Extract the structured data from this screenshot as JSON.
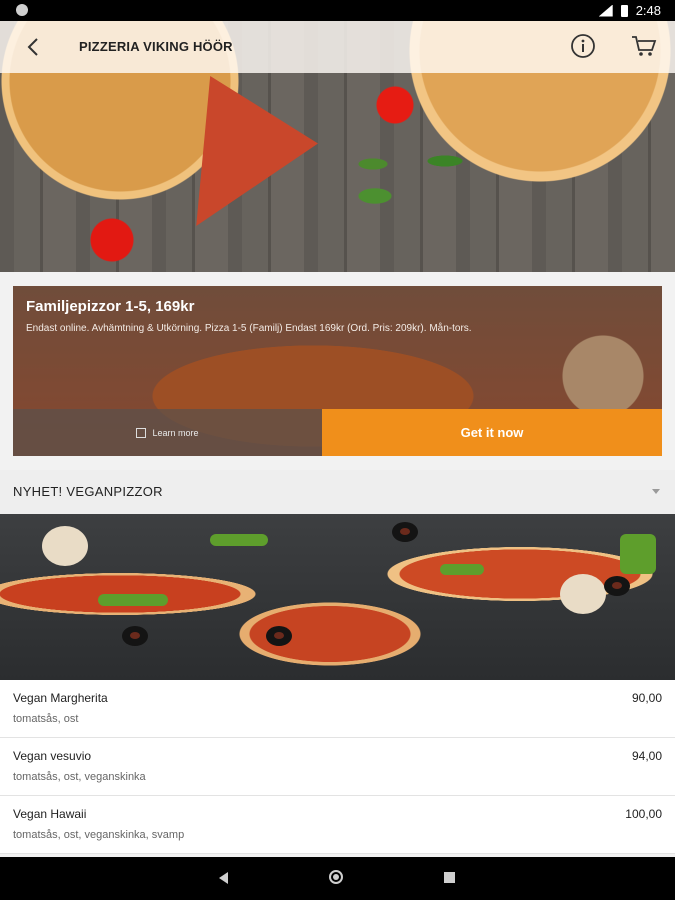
{
  "status_bar": {
    "time": "2:48"
  },
  "header": {
    "title": "PIZZERIA VIKING HÖÖR"
  },
  "promo": {
    "title": "Familjepizzor 1-5, 169kr",
    "text": "Endast online. Avhämtning & Utkörning. Pizza 1-5 (Familj) Endast 169kr (Ord. Pris: 209kr). Mån-tors.",
    "learn_more_label": "Learn more",
    "cta_label": "Get it now"
  },
  "category": {
    "label": "NYHET! VEGANPIZZOR"
  },
  "menu_items": [
    {
      "name": "Vegan Margherita",
      "desc": "tomatsås, ost",
      "price": "90,00"
    },
    {
      "name": "Vegan vesuvio",
      "desc": "tomatsås, ost, veganskinka",
      "price": "94,00"
    },
    {
      "name": "Vegan Hawaii",
      "desc": "tomatsås, ost, veganskinka, svamp",
      "price": "100,00"
    }
  ],
  "colors": {
    "accent": "#f08f1b",
    "status_bar": "#000000"
  },
  "icons": [
    "back-arrow-icon",
    "info-icon",
    "cart-icon",
    "chevron-down-icon"
  ]
}
